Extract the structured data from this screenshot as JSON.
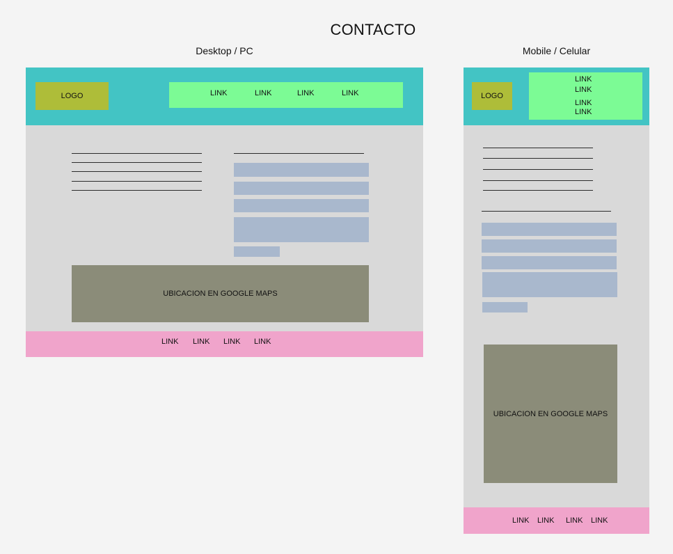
{
  "page": {
    "title": "CONTACTO"
  },
  "desktop": {
    "label": "Desktop / PC",
    "logo": "LOGO",
    "nav_links": [
      "LINK",
      "LINK",
      "LINK",
      "LINK"
    ],
    "map_label": "UBICACION EN GOOGLE MAPS",
    "footer_links": [
      "LINK",
      "LINK",
      "LINK",
      "LINK"
    ]
  },
  "mobile": {
    "label": "Mobile / Celular",
    "logo": "LOGO",
    "nav_links": [
      "LINK",
      "LINK",
      "LINK",
      "LINK"
    ],
    "map_label": "UBICACION EN GOOGLE MAPS",
    "footer_links": [
      "LINK",
      "LINK",
      "LINK",
      "LINK"
    ]
  },
  "colors": {
    "background": "#f4f4f4",
    "header": "#43c4c4",
    "logo": "#aebd39",
    "nav": "#7cfb95",
    "content": "#d9d9d9",
    "form_field": "#a9b8cd",
    "map": "#8b8c79",
    "footer": "#f0a4cb"
  }
}
